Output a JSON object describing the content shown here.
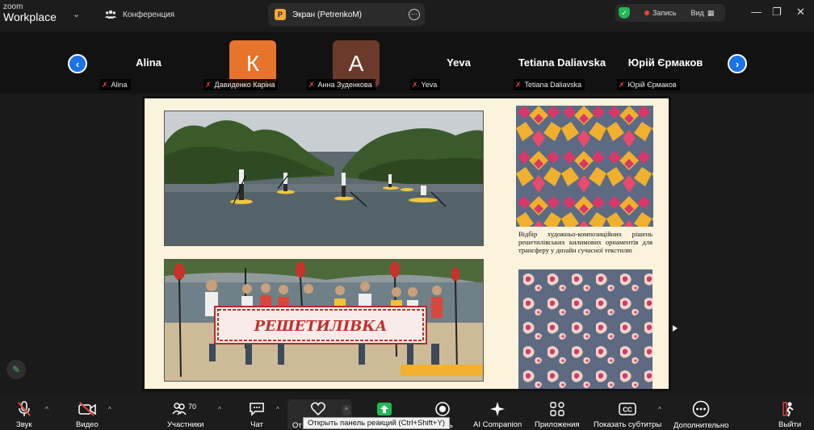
{
  "app": {
    "brand_top": "zoom",
    "brand_bottom": "Workplace"
  },
  "tabs": {
    "conference": "Конференция",
    "screen": "Экран (PetrenkoM)",
    "screen_icon_letter": "P"
  },
  "status": {
    "record_label": "Запись",
    "view_label": "Вид",
    "record_color": "#e8453c",
    "shield_color": "#20b955"
  },
  "participants": [
    {
      "display": "Alina",
      "label": "Alina",
      "type": "name"
    },
    {
      "display": "К",
      "label": "Давиденко Каріна",
      "type": "avatar",
      "color": "#e8742b"
    },
    {
      "display": "А",
      "label": "Анна Зуденкова",
      "type": "avatar",
      "color": "#6b3a2a"
    },
    {
      "display": "Yeva",
      "label": "Yeva",
      "type": "name"
    },
    {
      "display": "Tetiana Daliavska",
      "label": "Tetiana Daliavska",
      "type": "name"
    },
    {
      "display": "Юрій Єрмаков",
      "label": "Юрій Єрмаков",
      "type": "name"
    }
  ],
  "slide": {
    "caption": "Відбір художньо-композиційних рішень решетилівських килимових орнаментів для трансферу у дизайн сучасної текстилю",
    "banner_text": "РЕШЕТИЛІВКА",
    "background": "#fcf3dc"
  },
  "toolbar": {
    "sound": "Звук",
    "video": "Видео",
    "participants": "Участники",
    "participants_count": "70",
    "chat": "Чат",
    "reactions_partial": "От",
    "share_partial": "сь",
    "ai": "AI Companion",
    "apps": "Приложения",
    "captions": "Показать субтитры",
    "more": "Дополнительно",
    "leave": "Выйти",
    "tooltip": "Открыть панель реакций (Ctrl+Shift+Y)",
    "accent": "#1a73e8"
  }
}
